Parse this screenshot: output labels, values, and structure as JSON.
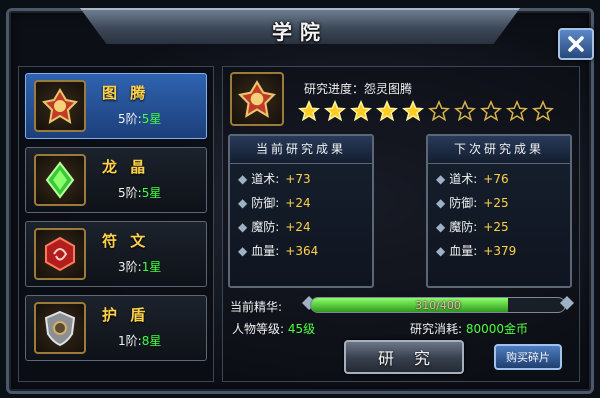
{
  "window": {
    "title": "学院"
  },
  "sidebar": {
    "items": [
      {
        "name": "图 腾",
        "level": "5阶:",
        "stars": "5星",
        "icon": "totem-icon",
        "selected": true
      },
      {
        "name": "龙 晶",
        "level": "5阶:",
        "stars": "5星",
        "icon": "dragon-crystal-icon",
        "selected": false
      },
      {
        "name": "符 文",
        "level": "3阶:",
        "stars": "1星",
        "icon": "rune-icon",
        "selected": false
      },
      {
        "name": "护 盾",
        "level": "1阶:",
        "stars": "8星",
        "icon": "shield-icon",
        "selected": false
      }
    ]
  },
  "research": {
    "progress_label": "研究进度：怨灵图腾",
    "stars_filled": 5,
    "stars_total": 10
  },
  "current_result": {
    "header": "当前研究成果",
    "rows": [
      {
        "label": "道术:",
        "value": "+73"
      },
      {
        "label": "防御:",
        "value": "+24"
      },
      {
        "label": "魔防:",
        "value": "+24"
      },
      {
        "label": "血量:",
        "value": "+364"
      }
    ]
  },
  "next_result": {
    "header": "下次研究成果",
    "rows": [
      {
        "label": "道术:",
        "value": "+76"
      },
      {
        "label": "防御:",
        "value": "+25"
      },
      {
        "label": "魔防:",
        "value": "+25"
      },
      {
        "label": "血量:",
        "value": "+379"
      }
    ]
  },
  "essence": {
    "label": "当前精华:",
    "bar_text": "310/400",
    "fill_fraction": 0.775
  },
  "player": {
    "level_label": "人物等级:",
    "level_value": "45级",
    "cost_label": "研究消耗:",
    "cost_value": "80000金币"
  },
  "buttons": {
    "research": "研究",
    "buy_fragments": "购买碎片"
  },
  "colors": {
    "accent_gold": "#ffd24a",
    "star_green": "#3cff3c",
    "selected_blue": "#2f63b0"
  }
}
